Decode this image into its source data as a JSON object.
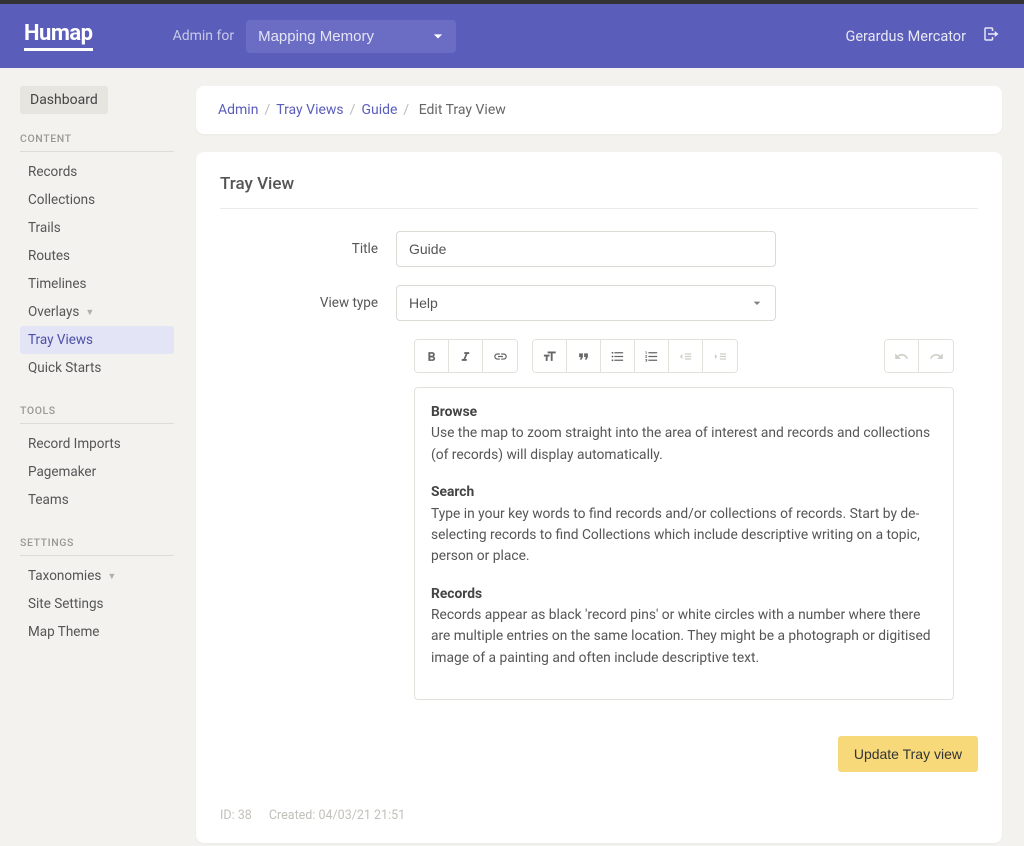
{
  "header": {
    "logo_text": "Humap",
    "admin_for_label": "Admin for",
    "project_selected": "Mapping Memory",
    "username": "Gerardus Mercator"
  },
  "sidebar": {
    "dashboard": "Dashboard",
    "sections": [
      {
        "title": "CONTENT",
        "items": [
          {
            "label": "Records",
            "active": false,
            "caret": false
          },
          {
            "label": "Collections",
            "active": false,
            "caret": false
          },
          {
            "label": "Trails",
            "active": false,
            "caret": false
          },
          {
            "label": "Routes",
            "active": false,
            "caret": false
          },
          {
            "label": "Timelines",
            "active": false,
            "caret": false
          },
          {
            "label": "Overlays",
            "active": false,
            "caret": true
          },
          {
            "label": "Tray Views",
            "active": true,
            "caret": false
          },
          {
            "label": "Quick Starts",
            "active": false,
            "caret": false
          }
        ]
      },
      {
        "title": "TOOLS",
        "items": [
          {
            "label": "Record Imports",
            "active": false,
            "caret": false
          },
          {
            "label": "Pagemaker",
            "active": false,
            "caret": false
          },
          {
            "label": "Teams",
            "active": false,
            "caret": false
          }
        ]
      },
      {
        "title": "SETTINGS",
        "items": [
          {
            "label": "Taxonomies",
            "active": false,
            "caret": true
          },
          {
            "label": "Site Settings",
            "active": false,
            "caret": false
          },
          {
            "label": "Map Theme",
            "active": false,
            "caret": false
          }
        ]
      }
    ]
  },
  "breadcrumbs": {
    "items": [
      "Admin",
      "Tray Views",
      "Guide"
    ],
    "current": "Edit Tray View"
  },
  "form": {
    "card_title": "Tray View",
    "title_label": "Title",
    "title_value": "Guide",
    "view_type_label": "View type",
    "view_type_value": "Help",
    "content": {
      "h1": "Browse",
      "p1": "Use the map to zoom straight into the area of interest and records and collections (of records) will display automatically.",
      "h2": "Search",
      "p2": "Type in your key words to find records and/or collections of records. Start by de-selecting records to find Collections which include descriptive writing on a topic, person or place.",
      "h3": "Records",
      "p3": "Records appear as black 'record pins' or white circles with a number where there are multiple entries on the same location. They might be a photograph or digitised image of a painting and often include descriptive text."
    },
    "submit_label": "Update Tray view",
    "meta_id": "ID: 38",
    "meta_created": "Created: 04/03/21 21:51"
  }
}
